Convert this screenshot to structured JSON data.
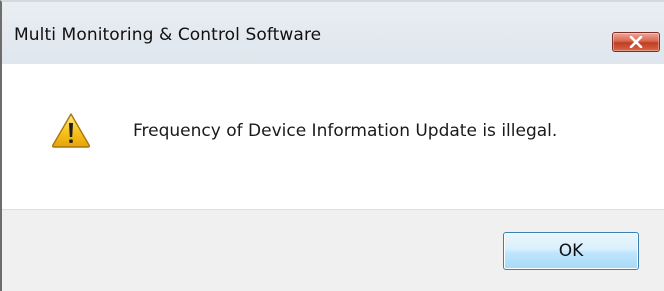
{
  "dialog": {
    "title": "Multi Monitoring & Control Software",
    "close_icon": "close-icon",
    "message_icon": "warning-icon",
    "message": "Frequency of Device Information Update is illegal.",
    "ok_label": "OK"
  },
  "colors": {
    "close_button": "#c94a32",
    "ok_button_border": "#3c7fb1",
    "footer_bg": "#f0f0f0",
    "warning_fill": "#f6c21b"
  }
}
